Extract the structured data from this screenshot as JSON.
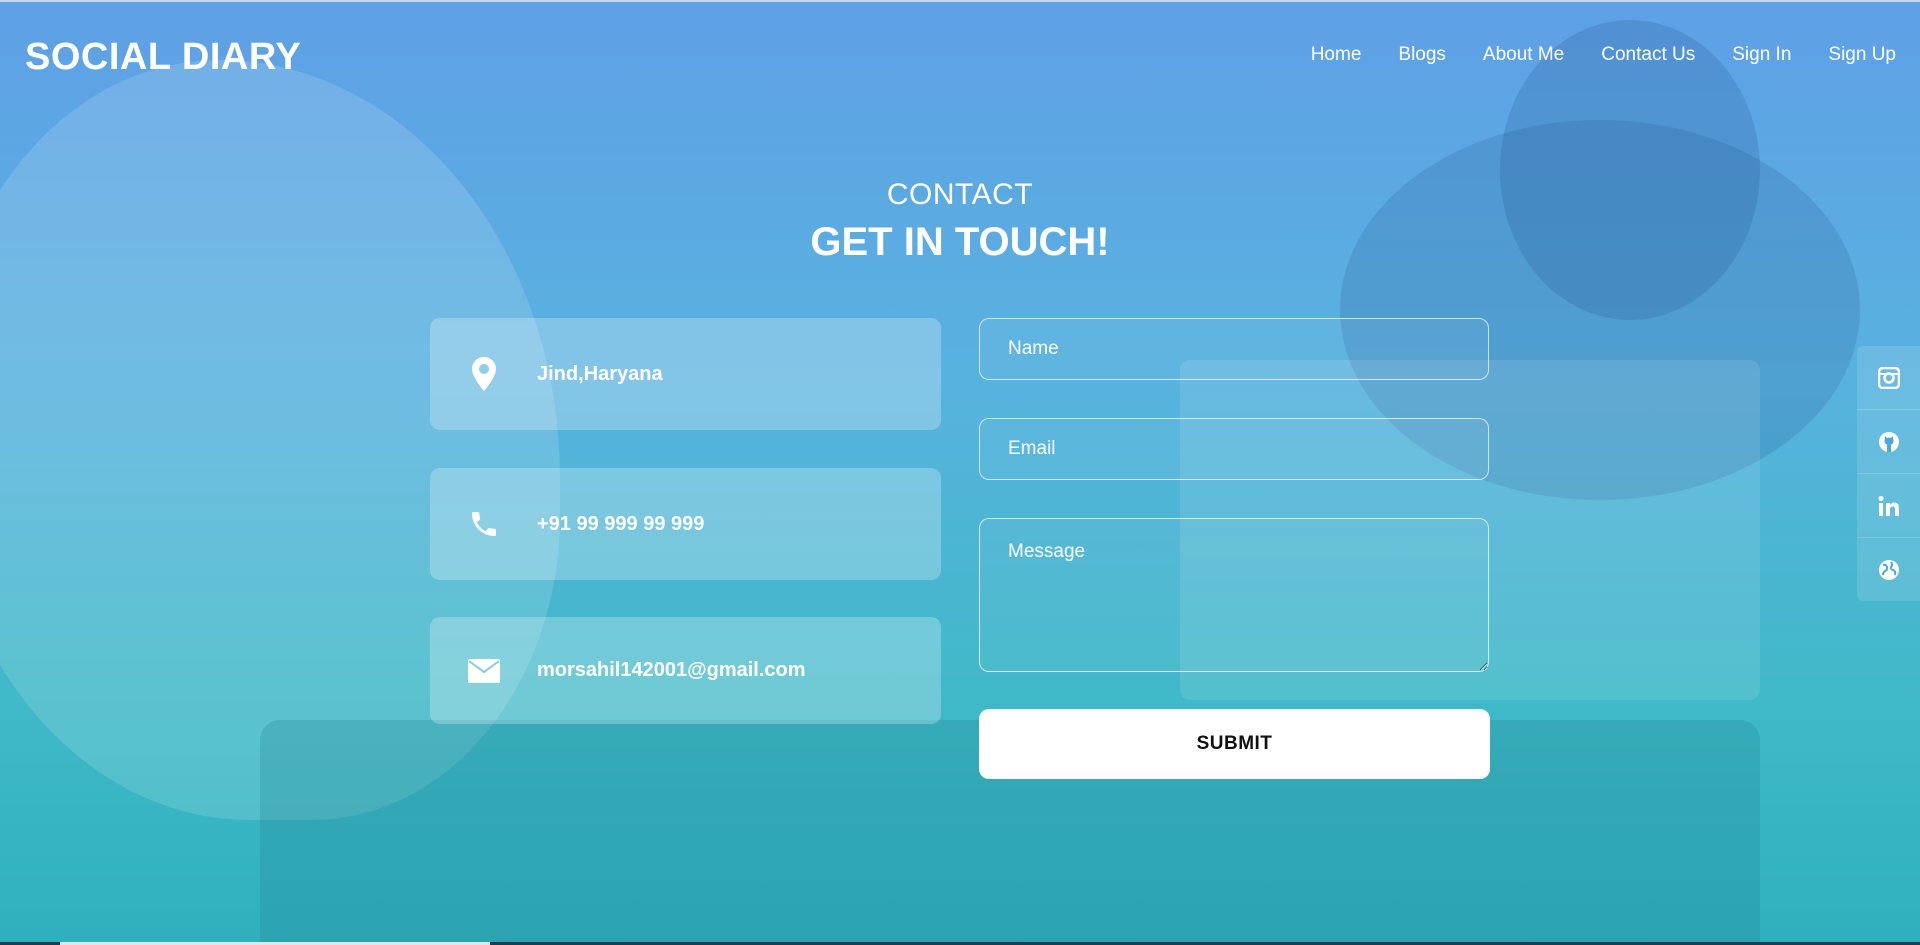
{
  "brand": {
    "logo": "SOCIAL DIARY"
  },
  "nav": {
    "items": [
      "Home",
      "Blogs",
      "About Me",
      "Contact Us",
      "Sign In",
      "Sign Up"
    ]
  },
  "section": {
    "subtitle": "CONTACT",
    "title": "GET IN TOUCH!"
  },
  "contact_info": {
    "location": "Jind,Haryana",
    "phone": "+91 99 999 99 999",
    "email": "morsahil142001@gmail.com"
  },
  "form": {
    "name_placeholder": "Name",
    "email_placeholder": "Email",
    "message_placeholder": "Message",
    "submit_label": "SUBMIT"
  },
  "social": {
    "icons": [
      "instagram-icon",
      "github-icon",
      "linkedin-icon",
      "globe-icon"
    ]
  },
  "colors": {
    "gradient_top": "#5fa0e6",
    "gradient_bottom": "#2fb0bd",
    "text": "#ffffff",
    "button_bg": "#ffffff",
    "button_text": "#111111"
  }
}
